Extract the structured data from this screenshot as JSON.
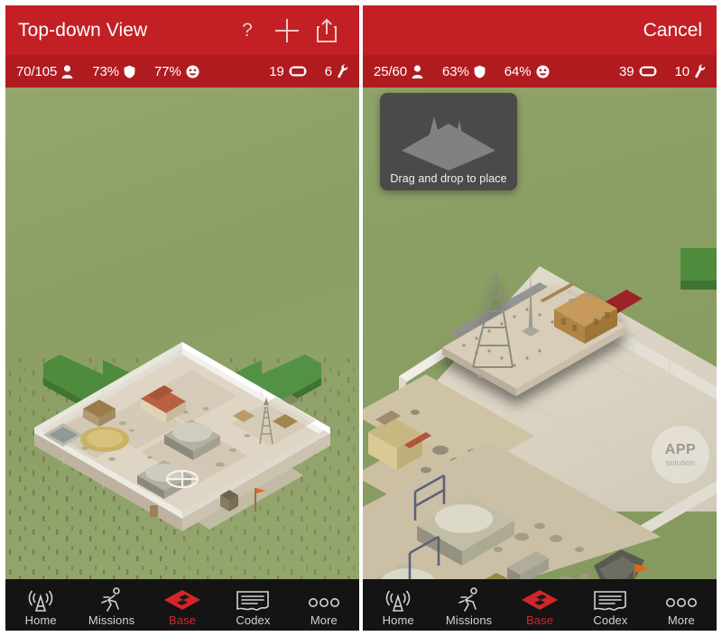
{
  "meta": {
    "app_kind": "isometric base-building game",
    "accent_red": "#c32025",
    "stats_red": "#b01b20",
    "tab_bg": "#141414",
    "active_red": "#d3252b",
    "field_green": "#8a9e63",
    "ground_tan": "#ded5c4"
  },
  "left": {
    "navbar": {
      "title": "Top-down View",
      "help_label": "?",
      "add_label": "+",
      "share_label": "share-icon"
    },
    "stats": {
      "population": {
        "value": "70/105",
        "icon": "person-icon"
      },
      "defense": {
        "value": "73%",
        "icon": "shield-icon"
      },
      "morale": {
        "value": "77%",
        "icon": "smiley-icon"
      },
      "power": {
        "value": "19",
        "icon": "battery-icon"
      },
      "maintenance": {
        "value": "6",
        "icon": "wrench-icon"
      }
    }
  },
  "right": {
    "navbar": {
      "cancel_label": "Cancel"
    },
    "stats": {
      "population": {
        "value": "25/60",
        "icon": "person-icon"
      },
      "defense": {
        "value": "63%",
        "icon": "shield-icon"
      },
      "morale": {
        "value": "64%",
        "icon": "smiley-icon"
      },
      "power": {
        "value": "39",
        "icon": "battery-icon"
      },
      "maintenance": {
        "value": "10",
        "icon": "wrench-icon"
      }
    },
    "drag_hint": {
      "label": "Drag and drop to place"
    },
    "watermark": {
      "line1": "APP",
      "line2": "solution"
    }
  },
  "tabs": [
    {
      "label": "Home",
      "icon": "antenna-icon",
      "active": false
    },
    {
      "label": "Missions",
      "icon": "runner-icon",
      "active": false
    },
    {
      "label": "Base",
      "icon": "diamond-base-icon",
      "active": true
    },
    {
      "label": "Codex",
      "icon": "document-icon",
      "active": false
    },
    {
      "label": "More",
      "icon": "ellipsis-icon",
      "active": false
    }
  ]
}
